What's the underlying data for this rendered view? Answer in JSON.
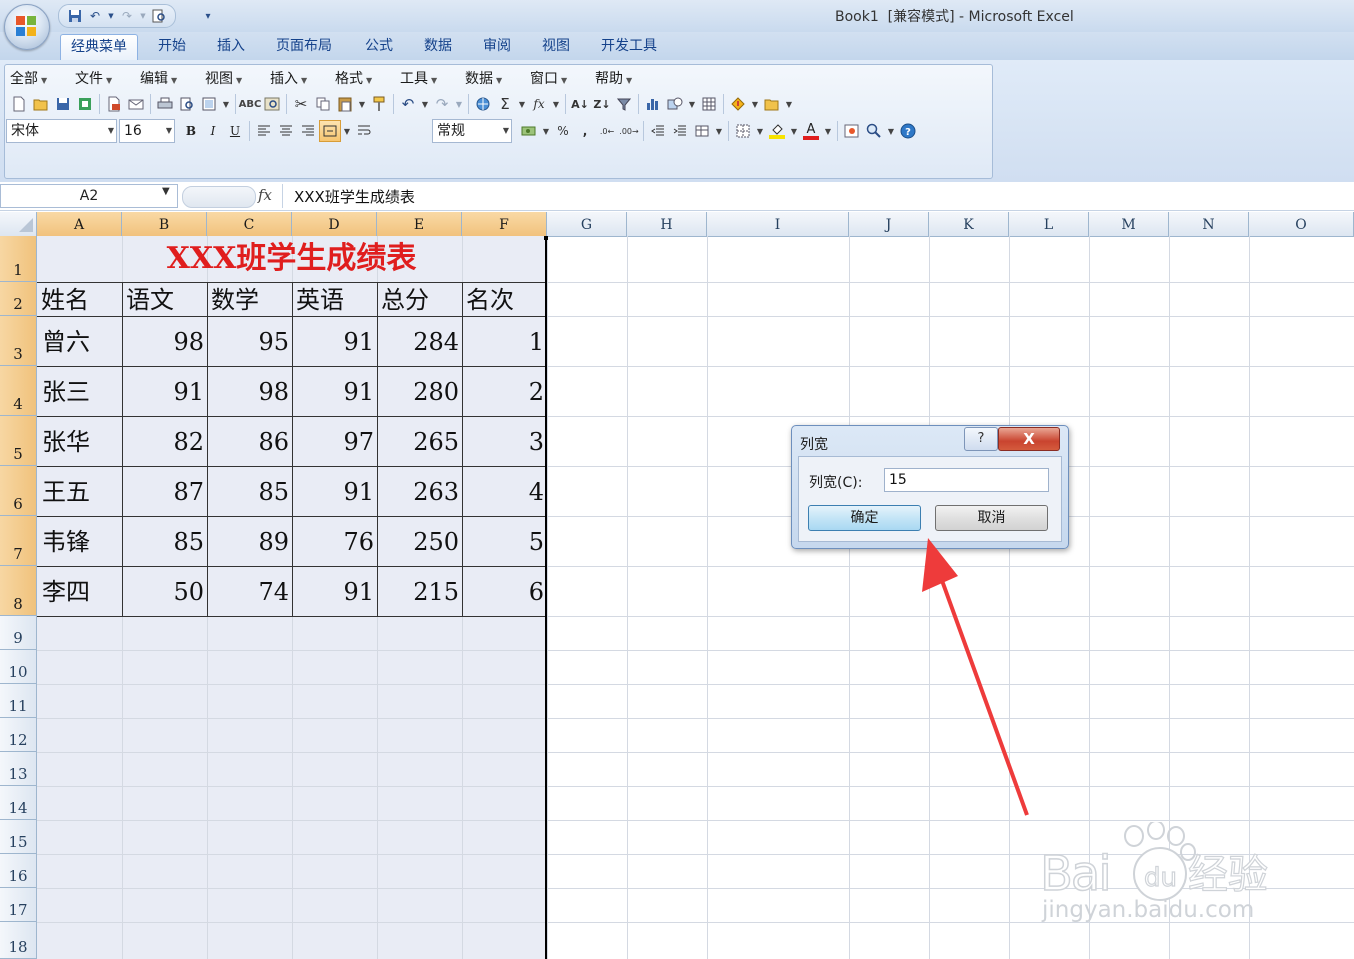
{
  "window": {
    "title": "Book1  [兼容模式] - Microsoft Excel"
  },
  "quick_access": {
    "icons": [
      "save-icon",
      "undo-icon",
      "redo-icon",
      "print-preview-icon",
      "customize-icon"
    ]
  },
  "ribbon_tabs": [
    "经典菜单",
    "开始",
    "插入",
    "页面布局",
    "公式",
    "数据",
    "审阅",
    "视图",
    "开发工具"
  ],
  "classic_menu": [
    "全部",
    "文件",
    "编辑",
    "视图",
    "插入",
    "格式",
    "工具",
    "数据",
    "窗口",
    "帮助"
  ],
  "toolbar": {
    "font_name": "宋体",
    "font_size": "16",
    "bold": "B",
    "italic": "I",
    "underline": "U",
    "number_format": "常规",
    "sum_symbol": "Σ",
    "fx_symbol": "fx",
    "percent": "%",
    "comma": ",",
    "font_color_letter": "A",
    "colors": {
      "highlight": "#f7e300",
      "font": "#e01e1e"
    }
  },
  "formula_bar": {
    "name_box": "A2",
    "fx_label": "fx",
    "content": "XXX班学生成绩表"
  },
  "grid": {
    "columns": [
      "A",
      "B",
      "C",
      "D",
      "E",
      "F",
      "G",
      "H",
      "I",
      "J",
      "K",
      "L",
      "M",
      "N",
      "O"
    ],
    "rows": [
      "1",
      "2",
      "3",
      "4",
      "5",
      "6",
      "7",
      "8",
      "9",
      "10",
      "11",
      "12",
      "13",
      "14",
      "15",
      "16",
      "17",
      "18"
    ]
  },
  "sheet": {
    "title": "XXX班学生成绩表",
    "title_color": "#e01e1e",
    "headers": [
      "姓名",
      "语文",
      "数学",
      "英语",
      "总分",
      "名次"
    ],
    "rows": [
      [
        "曾六",
        "98",
        "95",
        "91",
        "284",
        "1"
      ],
      [
        "张三",
        "91",
        "98",
        "91",
        "280",
        "2"
      ],
      [
        "张华",
        "82",
        "86",
        "97",
        "265",
        "3"
      ],
      [
        "王五",
        "87",
        "85",
        "91",
        "263",
        "4"
      ],
      [
        "韦锋",
        "85",
        "89",
        "76",
        "250",
        "5"
      ],
      [
        "李四",
        "50",
        "74",
        "91",
        "215",
        "6"
      ]
    ]
  },
  "dialog": {
    "title": "列宽",
    "help_label": "?",
    "close_label": "X",
    "field_label": "列宽(C):",
    "field_value": "15",
    "ok_label": "确定",
    "cancel_label": "取消"
  },
  "annotation": {
    "arrow_color": "#ee3b3b"
  },
  "watermark": {
    "brand": "Bai du 经验",
    "url": "jingyan.baidu.com"
  }
}
